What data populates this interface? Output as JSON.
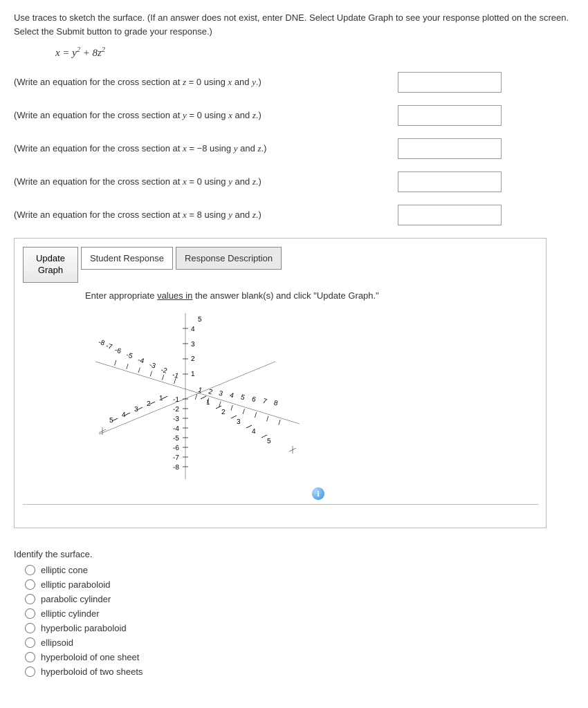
{
  "problem": {
    "intro": "Use traces to sketch the surface. (If an answer does not exist, enter DNE. Select Update Graph to see your response plotted on the screen. Select the Submit button to grade your response.)",
    "equation_html": "x = y² + 8z²"
  },
  "cross_sections": [
    {
      "text_pre": "(Write an equation for the cross section at ",
      "var1": "z",
      "mid": " = 0 using ",
      "var2": "x",
      "and": " and ",
      "var3": "y",
      "text_post": ".)"
    },
    {
      "text_pre": "(Write an equation for the cross section at ",
      "var1": "y",
      "mid": " = 0 using ",
      "var2": "x",
      "and": " and ",
      "var3": "z",
      "text_post": ".)"
    },
    {
      "text_pre": "(Write an equation for the cross section at ",
      "var1": "x",
      "mid": " = −8 using ",
      "var2": "y",
      "and": " and ",
      "var3": "z",
      "text_post": ".)"
    },
    {
      "text_pre": "(Write an equation for the cross section at ",
      "var1": "x",
      "mid": " = 0 using ",
      "var2": "y",
      "and": " and ",
      "var3": "z",
      "text_post": ".)"
    },
    {
      "text_pre": "(Write an equation for the cross section at ",
      "var1": "x",
      "mid": " = 8 using ",
      "var2": "y",
      "and": " and ",
      "var3": "z",
      "text_post": ".)"
    }
  ],
  "graph": {
    "update_btn": "Update Graph",
    "tab1": "Student Response",
    "tab2": "Response Description",
    "instruction_a": "Enter appropriate ",
    "instruction_u": "values in",
    "instruction_b": " the answer blank(s) and click \"Update Graph.\"",
    "axis_5": "5",
    "axis_ticks_pos": [
      "1",
      "2",
      "3",
      "4",
      "5",
      "6",
      "7",
      "8"
    ],
    "axis_ticks_neg": [
      "-1",
      "-2",
      "-3",
      "-4",
      "-5",
      "-6",
      "-7",
      "-8"
    ],
    "left_ticks": [
      "5",
      "4",
      "3",
      "2",
      "1"
    ],
    "z_ticks_pos": [
      "1",
      "2",
      "3",
      "4"
    ],
    "z_ticks_neg": [
      "-1",
      "-2",
      "-3",
      "-4",
      "-5",
      "-6",
      "-7",
      "-8"
    ]
  },
  "identify": {
    "title": "Identify the surface.",
    "options": [
      "elliptic cone",
      "elliptic paraboloid",
      "parabolic cylinder",
      "elliptic cylinder",
      "hyperbolic paraboloid",
      "ellipsoid",
      "hyperboloid of one sheet",
      "hyperboloid of two sheets"
    ]
  }
}
